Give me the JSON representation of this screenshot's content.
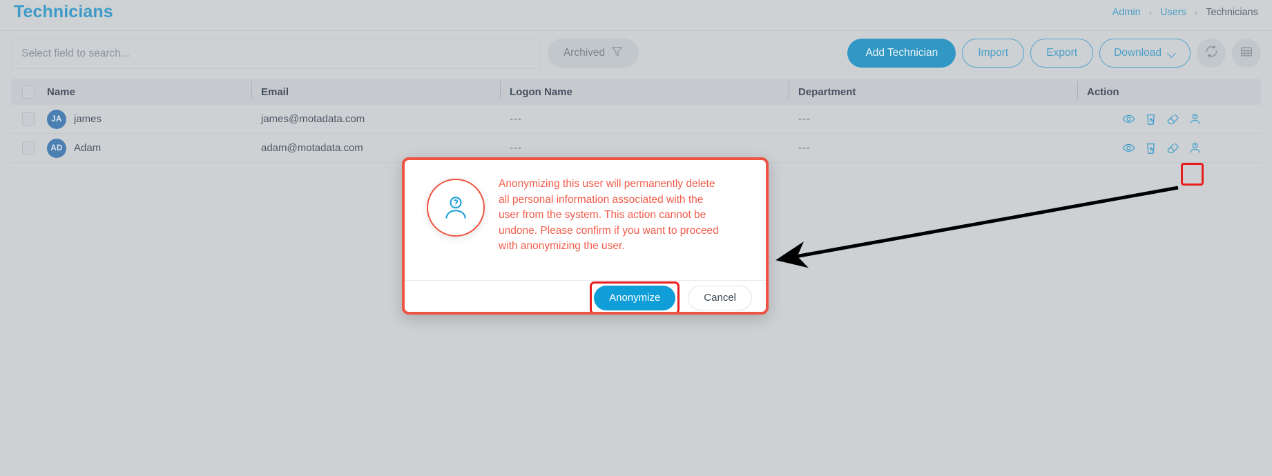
{
  "header": {
    "title": "Technicians",
    "breadcrumb": [
      {
        "label": "Admin",
        "type": "link"
      },
      {
        "label": "Users",
        "type": "link"
      },
      {
        "label": "Technicians",
        "type": "current"
      }
    ],
    "separator": "›"
  },
  "toolbar": {
    "search_placeholder": "Select field to search...",
    "search_value": "",
    "archived_label": "Archived",
    "filter_icon": "funnel-icon",
    "add_label": "Add Technician",
    "import_label": "Import",
    "export_label": "Export",
    "download_label": "Download",
    "download_chevron": "chevron-down-icon",
    "refresh_icon": "refresh-icon",
    "grid_icon": "table-view-icon"
  },
  "table": {
    "columns": [
      "Name",
      "Email",
      "Logon Name",
      "Department",
      "Action"
    ],
    "empty_value": "---",
    "rows": [
      {
        "initials": "JA",
        "name": "james",
        "email": "james@motadata.com",
        "logon_name": "---",
        "department": "---",
        "actions": [
          "view-icon",
          "archive-icon",
          "eraser-icon",
          "anonymize-user-icon"
        ]
      },
      {
        "initials": "AD",
        "name": "Adam",
        "email": "adam@motadata.com",
        "logon_name": "---",
        "department": "---",
        "actions": [
          "view-icon",
          "archive-icon",
          "eraser-icon",
          "anonymize-user-icon"
        ]
      }
    ]
  },
  "modal": {
    "icon": "anonymize-user-icon",
    "message": "Anonymizing this user will permanently delete all personal information associated with the user from the system. This action cannot be undone. Please confirm if you want to proceed with anonymizing the user.",
    "confirm_label": "Anonymize",
    "cancel_label": "Cancel"
  },
  "annotation": {
    "arrow": "points from the highlighted anonymize icon on the Adam row to the modal dialog",
    "highlight_color": "#e81c1c"
  },
  "colors": {
    "page_background": "#cdd1d4",
    "title": "#3e9bc8",
    "primary_button": "#3197c4",
    "modal_accent": "#f05443",
    "modal_confirm": "#0f9ed8",
    "avatar": "#4b7fb1",
    "highlight": "#e81c1c"
  }
}
